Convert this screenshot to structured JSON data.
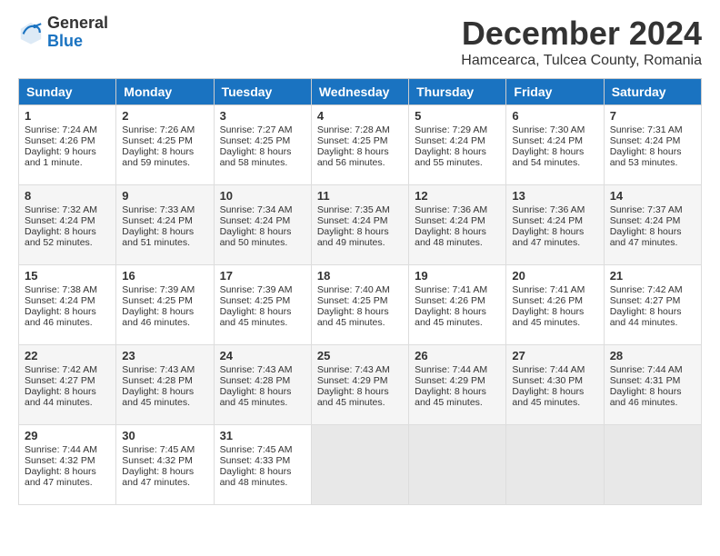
{
  "logo": {
    "general": "General",
    "blue": "Blue"
  },
  "title": {
    "month": "December 2024",
    "location": "Hamcearca, Tulcea County, Romania"
  },
  "headers": [
    "Sunday",
    "Monday",
    "Tuesday",
    "Wednesday",
    "Thursday",
    "Friday",
    "Saturday"
  ],
  "weeks": [
    [
      {
        "day": "1",
        "sunrise": "Sunrise: 7:24 AM",
        "sunset": "Sunset: 4:26 PM",
        "daylight": "Daylight: 9 hours and 1 minute."
      },
      {
        "day": "2",
        "sunrise": "Sunrise: 7:26 AM",
        "sunset": "Sunset: 4:25 PM",
        "daylight": "Daylight: 8 hours and 59 minutes."
      },
      {
        "day": "3",
        "sunrise": "Sunrise: 7:27 AM",
        "sunset": "Sunset: 4:25 PM",
        "daylight": "Daylight: 8 hours and 58 minutes."
      },
      {
        "day": "4",
        "sunrise": "Sunrise: 7:28 AM",
        "sunset": "Sunset: 4:25 PM",
        "daylight": "Daylight: 8 hours and 56 minutes."
      },
      {
        "day": "5",
        "sunrise": "Sunrise: 7:29 AM",
        "sunset": "Sunset: 4:24 PM",
        "daylight": "Daylight: 8 hours and 55 minutes."
      },
      {
        "day": "6",
        "sunrise": "Sunrise: 7:30 AM",
        "sunset": "Sunset: 4:24 PM",
        "daylight": "Daylight: 8 hours and 54 minutes."
      },
      {
        "day": "7",
        "sunrise": "Sunrise: 7:31 AM",
        "sunset": "Sunset: 4:24 PM",
        "daylight": "Daylight: 8 hours and 53 minutes."
      }
    ],
    [
      {
        "day": "8",
        "sunrise": "Sunrise: 7:32 AM",
        "sunset": "Sunset: 4:24 PM",
        "daylight": "Daylight: 8 hours and 52 minutes."
      },
      {
        "day": "9",
        "sunrise": "Sunrise: 7:33 AM",
        "sunset": "Sunset: 4:24 PM",
        "daylight": "Daylight: 8 hours and 51 minutes."
      },
      {
        "day": "10",
        "sunrise": "Sunrise: 7:34 AM",
        "sunset": "Sunset: 4:24 PM",
        "daylight": "Daylight: 8 hours and 50 minutes."
      },
      {
        "day": "11",
        "sunrise": "Sunrise: 7:35 AM",
        "sunset": "Sunset: 4:24 PM",
        "daylight": "Daylight: 8 hours and 49 minutes."
      },
      {
        "day": "12",
        "sunrise": "Sunrise: 7:36 AM",
        "sunset": "Sunset: 4:24 PM",
        "daylight": "Daylight: 8 hours and 48 minutes."
      },
      {
        "day": "13",
        "sunrise": "Sunrise: 7:36 AM",
        "sunset": "Sunset: 4:24 PM",
        "daylight": "Daylight: 8 hours and 47 minutes."
      },
      {
        "day": "14",
        "sunrise": "Sunrise: 7:37 AM",
        "sunset": "Sunset: 4:24 PM",
        "daylight": "Daylight: 8 hours and 47 minutes."
      }
    ],
    [
      {
        "day": "15",
        "sunrise": "Sunrise: 7:38 AM",
        "sunset": "Sunset: 4:24 PM",
        "daylight": "Daylight: 8 hours and 46 minutes."
      },
      {
        "day": "16",
        "sunrise": "Sunrise: 7:39 AM",
        "sunset": "Sunset: 4:25 PM",
        "daylight": "Daylight: 8 hours and 46 minutes."
      },
      {
        "day": "17",
        "sunrise": "Sunrise: 7:39 AM",
        "sunset": "Sunset: 4:25 PM",
        "daylight": "Daylight: 8 hours and 45 minutes."
      },
      {
        "day": "18",
        "sunrise": "Sunrise: 7:40 AM",
        "sunset": "Sunset: 4:25 PM",
        "daylight": "Daylight: 8 hours and 45 minutes."
      },
      {
        "day": "19",
        "sunrise": "Sunrise: 7:41 AM",
        "sunset": "Sunset: 4:26 PM",
        "daylight": "Daylight: 8 hours and 45 minutes."
      },
      {
        "day": "20",
        "sunrise": "Sunrise: 7:41 AM",
        "sunset": "Sunset: 4:26 PM",
        "daylight": "Daylight: 8 hours and 45 minutes."
      },
      {
        "day": "21",
        "sunrise": "Sunrise: 7:42 AM",
        "sunset": "Sunset: 4:27 PM",
        "daylight": "Daylight: 8 hours and 44 minutes."
      }
    ],
    [
      {
        "day": "22",
        "sunrise": "Sunrise: 7:42 AM",
        "sunset": "Sunset: 4:27 PM",
        "daylight": "Daylight: 8 hours and 44 minutes."
      },
      {
        "day": "23",
        "sunrise": "Sunrise: 7:43 AM",
        "sunset": "Sunset: 4:28 PM",
        "daylight": "Daylight: 8 hours and 45 minutes."
      },
      {
        "day": "24",
        "sunrise": "Sunrise: 7:43 AM",
        "sunset": "Sunset: 4:28 PM",
        "daylight": "Daylight: 8 hours and 45 minutes."
      },
      {
        "day": "25",
        "sunrise": "Sunrise: 7:43 AM",
        "sunset": "Sunset: 4:29 PM",
        "daylight": "Daylight: 8 hours and 45 minutes."
      },
      {
        "day": "26",
        "sunrise": "Sunrise: 7:44 AM",
        "sunset": "Sunset: 4:29 PM",
        "daylight": "Daylight: 8 hours and 45 minutes."
      },
      {
        "day": "27",
        "sunrise": "Sunrise: 7:44 AM",
        "sunset": "Sunset: 4:30 PM",
        "daylight": "Daylight: 8 hours and 45 minutes."
      },
      {
        "day": "28",
        "sunrise": "Sunrise: 7:44 AM",
        "sunset": "Sunset: 4:31 PM",
        "daylight": "Daylight: 8 hours and 46 minutes."
      }
    ],
    [
      {
        "day": "29",
        "sunrise": "Sunrise: 7:44 AM",
        "sunset": "Sunset: 4:32 PM",
        "daylight": "Daylight: 8 hours and 47 minutes."
      },
      {
        "day": "30",
        "sunrise": "Sunrise: 7:45 AM",
        "sunset": "Sunset: 4:32 PM",
        "daylight": "Daylight: 8 hours and 47 minutes."
      },
      {
        "day": "31",
        "sunrise": "Sunrise: 7:45 AM",
        "sunset": "Sunset: 4:33 PM",
        "daylight": "Daylight: 8 hours and 48 minutes."
      },
      null,
      null,
      null,
      null
    ]
  ]
}
